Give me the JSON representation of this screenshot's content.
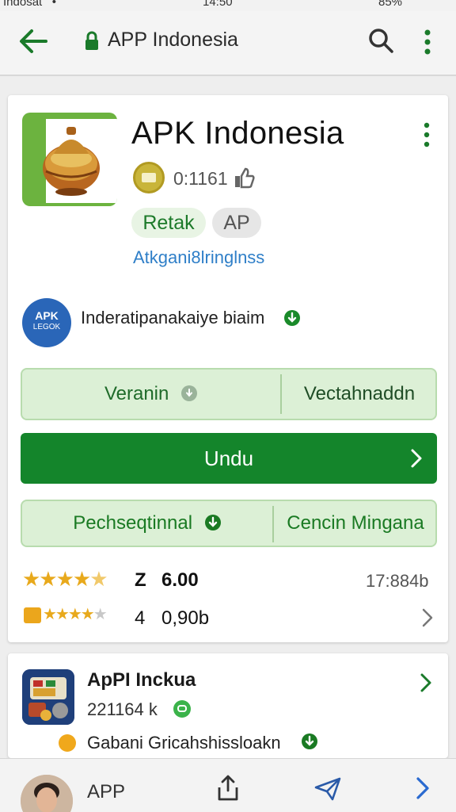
{
  "status_bar": {
    "carrier": "Indosat   •",
    "time": "14:50",
    "battery": "85%"
  },
  "address_bar": {
    "url": "APP Indonesia",
    "icons": [
      "back-arrow-icon",
      "lock-icon",
      "search-icon",
      "more-vert-icon"
    ]
  },
  "app": {
    "title": "APK Indonesia",
    "meta_count": "0:1161",
    "chips": [
      "Retak",
      "AP"
    ],
    "link": "Atkgani8lringlnss",
    "developer": {
      "logo_line1": "APK",
      "logo_line2": "LEGOK",
      "name": "Inderatipanakaiye biaim"
    },
    "buttons": {
      "row1_left": "Veranin",
      "row1_right": "Vectahnaddn",
      "primary": "Undu",
      "row3_left": "Pechseqtinnal",
      "row3_right": "Cencin Mingana"
    },
    "ratings": {
      "row1_value_a": "Z",
      "row1_value_b": "6.00",
      "row1_right": "17:884b",
      "row2_value_a": "4",
      "row2_value_b": "0,90b"
    }
  },
  "related": {
    "title": "ApPI Inckua",
    "count": "221164 k",
    "description": "Gabani Gricahshissloakn"
  },
  "bottom_bar": {
    "label": "APP"
  },
  "colors": {
    "accent_green": "#14852b",
    "light_green": "#dcf0d6",
    "link_blue": "#2f7fc8",
    "star_gold": "#e8a91c"
  }
}
